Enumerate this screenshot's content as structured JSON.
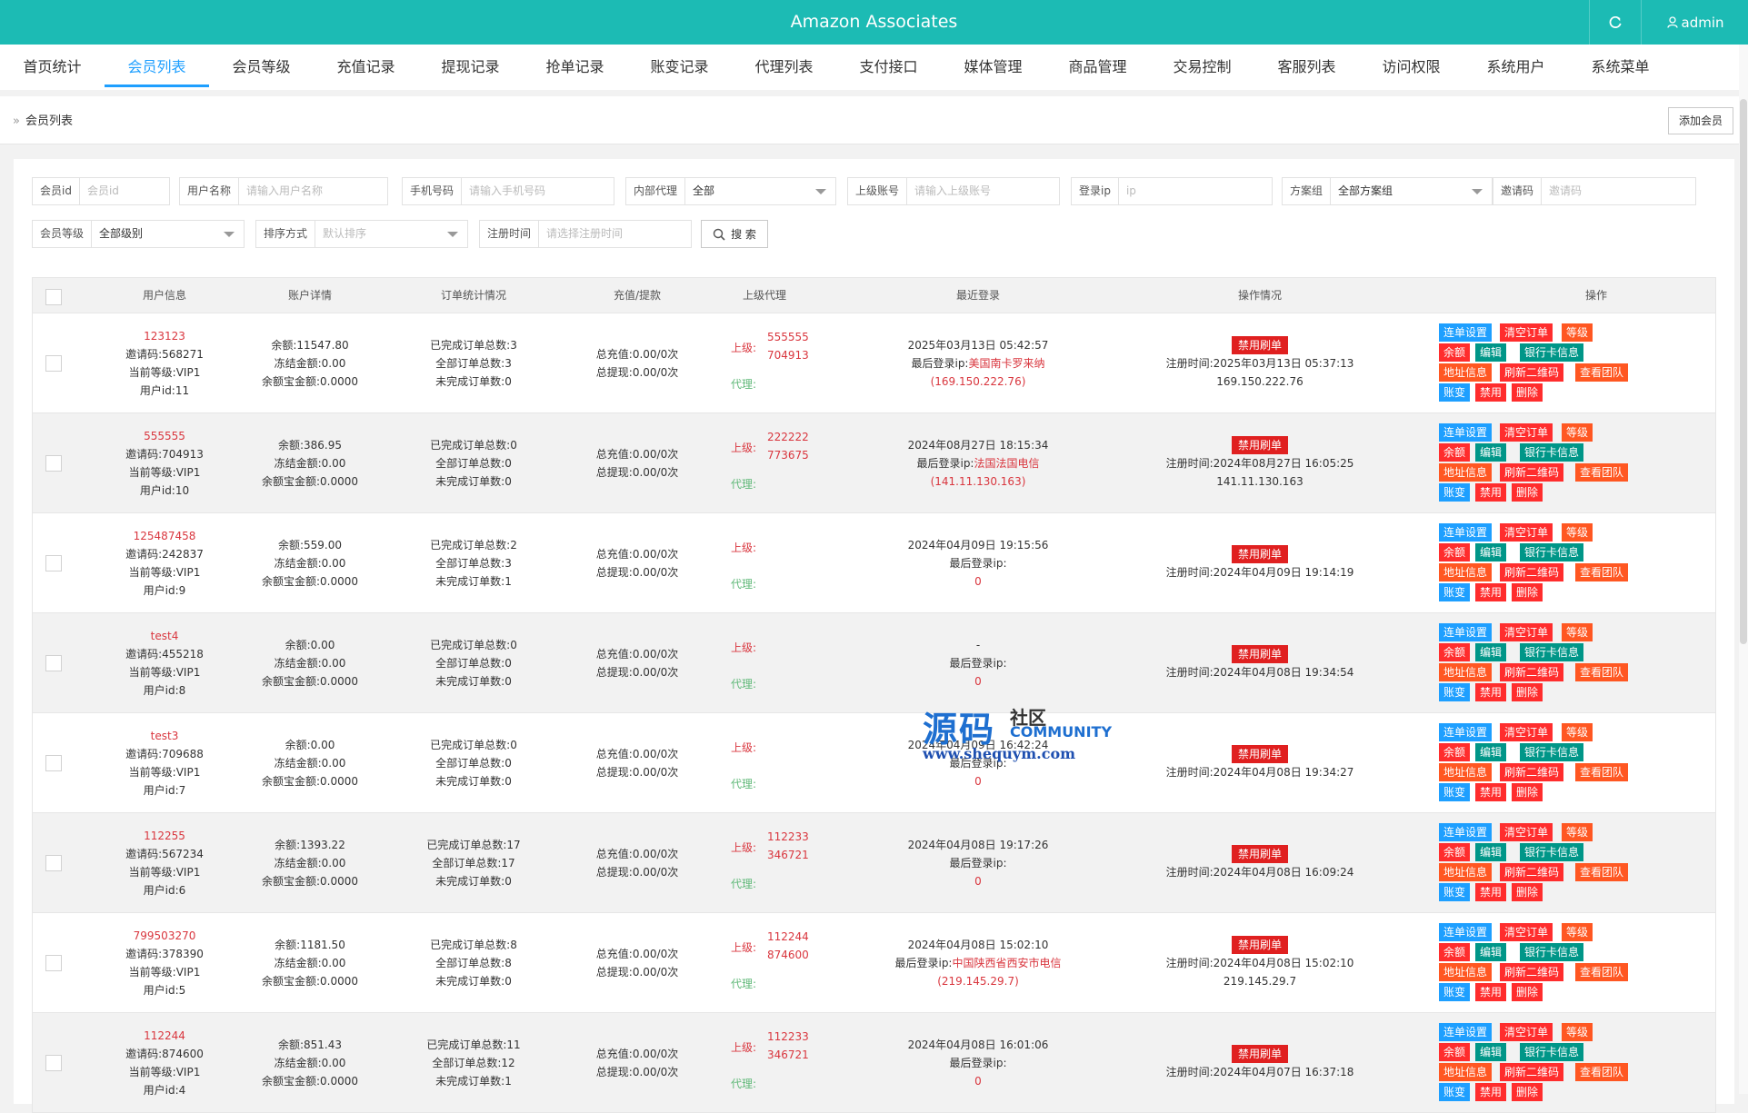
{
  "header": {
    "title": "Amazon Associates",
    "user": "admin"
  },
  "nav": [
    {
      "label": "首页统计",
      "active": false
    },
    {
      "label": "会员列表",
      "active": true
    },
    {
      "label": "会员等级",
      "active": false
    },
    {
      "label": "充值记录",
      "active": false
    },
    {
      "label": "提现记录",
      "active": false
    },
    {
      "label": "抢单记录",
      "active": false
    },
    {
      "label": "账变记录",
      "active": false
    },
    {
      "label": "代理列表",
      "active": false
    },
    {
      "label": "支付接口",
      "active": false
    },
    {
      "label": "媒体管理",
      "active": false
    },
    {
      "label": "商品管理",
      "active": false
    },
    {
      "label": "交易控制",
      "active": false
    },
    {
      "label": "客服列表",
      "active": false
    },
    {
      "label": "访问权限",
      "active": false
    },
    {
      "label": "系统用户",
      "active": false
    },
    {
      "label": "系统菜单",
      "active": false
    }
  ],
  "breadcrumb": "会员列表",
  "add_button": "添加会员",
  "filters": {
    "member_id": {
      "label": "会员id",
      "placeholder": "会员id"
    },
    "username": {
      "label": "用户名称",
      "placeholder": "请输入用户名称"
    },
    "phone": {
      "label": "手机号码",
      "placeholder": "请输入手机号码"
    },
    "agent": {
      "label": "内部代理",
      "value": "全部"
    },
    "parent": {
      "label": "上级账号",
      "placeholder": "请输入上级账号"
    },
    "login_ip": {
      "label": "登录ip",
      "placeholder": "ip"
    },
    "plan": {
      "label": "方案组",
      "value": "全部方案组"
    },
    "invite": {
      "label": "邀请码",
      "placeholder": "邀请码"
    },
    "level": {
      "label": "会员等级",
      "value": "全部级别"
    },
    "sort": {
      "label": "排序方式",
      "value": "默认排序"
    },
    "reg_time": {
      "label": "注册时间",
      "placeholder": "请选择注册时间"
    },
    "search_label": "搜 索"
  },
  "columns": {
    "user": "用户信息",
    "account": "账户详情",
    "orders": "订单统计情况",
    "recharge": "充值/提款",
    "parent": "上级代理",
    "last_login": "最近登录",
    "status": "操作情况",
    "ops": "操作"
  },
  "labels": {
    "invite": "邀请码:",
    "level": "当前等级:",
    "uid": "用户id:",
    "balance": "余额:",
    "frozen": "冻结金额:",
    "yuebao": "余额宝金额:",
    "done": "已完成订单总数:",
    "all": "全部订单总数:",
    "undone": "未完成订单数:",
    "recharge": "总充值:",
    "withdraw": "总提现:",
    "superior": "上级:",
    "agent": "代理:",
    "last_ip": "最后登录ip:",
    "ban": "禁用刷单",
    "reg": "注册时间:"
  },
  "actions": [
    {
      "label": "连单设置",
      "color": "#1e9fff"
    },
    {
      "label": "清空订单",
      "color": "#ff2d2d"
    },
    {
      "label": "等级",
      "color": "#ff5722"
    },
    {
      "label": "余额",
      "color": "#ff2d2d"
    },
    {
      "label": "编辑",
      "color": "#009688"
    },
    {
      "label": "银行卡信息",
      "color": "#009688"
    },
    {
      "label": "地址信息",
      "color": "#ff5722"
    },
    {
      "label": "刷新二维码",
      "color": "#ff2d2d"
    },
    {
      "label": "查看团队",
      "color": "#ff5722"
    },
    {
      "label": "账变",
      "color": "#1e9fff"
    },
    {
      "label": "禁用",
      "color": "#ff2d2d"
    },
    {
      "label": "删除",
      "color": "#ff2d2d"
    }
  ],
  "rows": [
    {
      "name": "123123",
      "invite": "568271",
      "level": "VIP1",
      "uid": "11",
      "balance": "11547.80",
      "frozen": "0.00",
      "yuebao": "0.0000",
      "done": "3",
      "all": "3",
      "undone": "0",
      "recharge": "0.00/0次",
      "withdraw": "0.00/0次",
      "parent1": "555555",
      "parent2": "704913",
      "login_time": "2025年03月13日 05:42:57",
      "login_loc": "美国南卡罗来纳",
      "login_ip": "(169.150.222.76)",
      "reg_time": "2025年03月13日 05:37:13",
      "reg_ip": "169.150.222.76"
    },
    {
      "name": "555555",
      "invite": "704913",
      "level": "VIP1",
      "uid": "10",
      "balance": "386.95",
      "frozen": "0.00",
      "yuebao": "0.0000",
      "done": "0",
      "all": "0",
      "undone": "0",
      "recharge": "0.00/0次",
      "withdraw": "0.00/0次",
      "parent1": "222222",
      "parent2": "773675",
      "login_time": "2024年08月27日 18:15:34",
      "login_loc": "法国法国电信",
      "login_ip": "(141.11.130.163)",
      "reg_time": "2024年08月27日 16:05:25",
      "reg_ip": "141.11.130.163"
    },
    {
      "name": "125487458",
      "invite": "242837",
      "level": "VIP1",
      "uid": "9",
      "balance": "559.00",
      "frozen": "0.00",
      "yuebao": "0.0000",
      "done": "2",
      "all": "3",
      "undone": "1",
      "recharge": "0.00/0次",
      "withdraw": "0.00/0次",
      "parent1": "",
      "parent2": "",
      "login_time": "2024年04月09日 19:15:56",
      "login_loc": "",
      "login_ip": "0",
      "reg_time": "2024年04月09日 19:14:19",
      "reg_ip": ""
    },
    {
      "name": "test4",
      "invite": "455218",
      "level": "VIP1",
      "uid": "8",
      "balance": "0.00",
      "frozen": "0.00",
      "yuebao": "0.0000",
      "done": "0",
      "all": "0",
      "undone": "0",
      "recharge": "0.00/0次",
      "withdraw": "0.00/0次",
      "parent1": "",
      "parent2": "",
      "login_time": "-",
      "login_loc": "",
      "login_ip": "0",
      "reg_time": "2024年04月08日 19:34:54",
      "reg_ip": ""
    },
    {
      "name": "test3",
      "invite": "709688",
      "level": "VIP1",
      "uid": "7",
      "balance": "0.00",
      "frozen": "0.00",
      "yuebao": "0.0000",
      "done": "0",
      "all": "0",
      "undone": "0",
      "recharge": "0.00/0次",
      "withdraw": "0.00/0次",
      "parent1": "",
      "parent2": "",
      "login_time": "2024年04月09日 16:42:24",
      "login_loc": "",
      "login_ip": "0",
      "reg_time": "2024年04月08日 19:34:27",
      "reg_ip": ""
    },
    {
      "name": "112255",
      "invite": "567234",
      "level": "VIP1",
      "uid": "6",
      "balance": "1393.22",
      "frozen": "0.00",
      "yuebao": "0.0000",
      "done": "17",
      "all": "17",
      "undone": "0",
      "recharge": "0.00/0次",
      "withdraw": "0.00/0次",
      "parent1": "112233",
      "parent2": "346721",
      "login_time": "2024年04月08日 19:17:26",
      "login_loc": "",
      "login_ip": "0",
      "reg_time": "2024年04月08日 16:09:24",
      "reg_ip": ""
    },
    {
      "name": "799503270",
      "invite": "378390",
      "level": "VIP1",
      "uid": "5",
      "balance": "1181.50",
      "frozen": "0.00",
      "yuebao": "0.0000",
      "done": "8",
      "all": "8",
      "undone": "0",
      "recharge": "0.00/0次",
      "withdraw": "0.00/0次",
      "parent1": "112244",
      "parent2": "874600",
      "login_time": "2024年04月08日 15:02:10",
      "login_loc": "中国陕西省西安市电信",
      "login_ip": "(219.145.29.7)",
      "reg_time": "2024年04月08日 15:02:10",
      "reg_ip": "219.145.29.7"
    },
    {
      "name": "112244",
      "invite": "874600",
      "level": "VIP1",
      "uid": "4",
      "balance": "851.43",
      "frozen": "0.00",
      "yuebao": "0.0000",
      "done": "11",
      "all": "12",
      "undone": "1",
      "recharge": "0.00/0次",
      "withdraw": "0.00/0次",
      "parent1": "112233",
      "parent2": "346721",
      "login_time": "2024年04月08日 16:01:06",
      "login_loc": "",
      "login_ip": "0",
      "reg_time": "2024年04月07日 16:37:18",
      "reg_ip": ""
    }
  ],
  "watermark": {
    "main": "源码",
    "side": "社区",
    "community": "COMMUNITY",
    "url": "www.shequym.com"
  }
}
